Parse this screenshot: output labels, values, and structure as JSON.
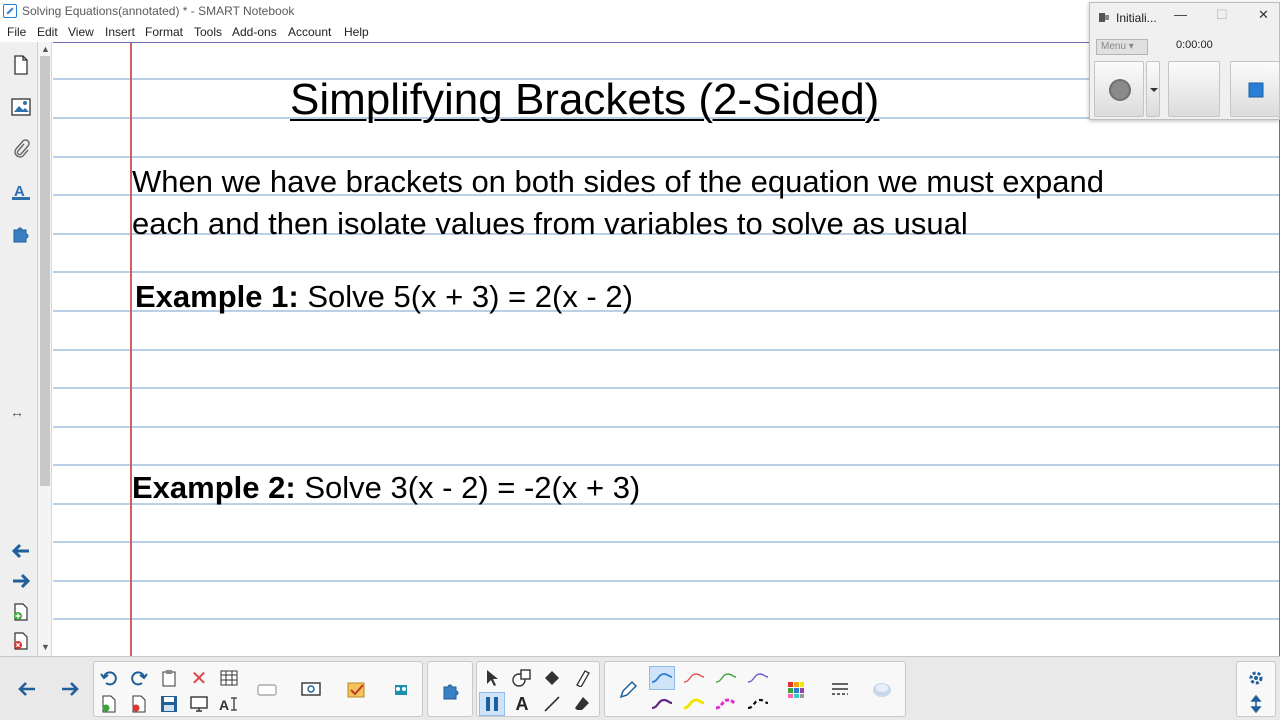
{
  "window": {
    "title": "Solving Equations(annotated) * - SMART Notebook"
  },
  "menu": [
    "File",
    "Edit",
    "View",
    "Insert",
    "Format",
    "Tools",
    "Add-ons",
    "Account",
    "Help"
  ],
  "page": {
    "title": "Simplifying Brackets (2-Sided)",
    "intro_line1": "When we have brackets on both sides of the equation we must expand",
    "intro_line2": "each and then isolate values from variables to solve as usual",
    "example1_label": "Example 1:",
    "example1_text": " Solve 5(x + 3) = 2(x - 2)",
    "example2_label": "Example 2:",
    "example2_text": " Solve 3(x - 2) = -2(x + 3)"
  },
  "recorder": {
    "title": "Initiali...",
    "menu_label": "Menu",
    "time": "0:00:00"
  },
  "sidebar_icons": [
    "page-sorter-icon",
    "gallery-icon",
    "attachments-icon",
    "properties-icon",
    "add-ons-icon"
  ],
  "colors": {
    "rule_line": "#b9d0e6",
    "margin_line": "#d06060",
    "nav_arrow": "#1f5f9a",
    "accent_blue": "#2a7fd4"
  }
}
